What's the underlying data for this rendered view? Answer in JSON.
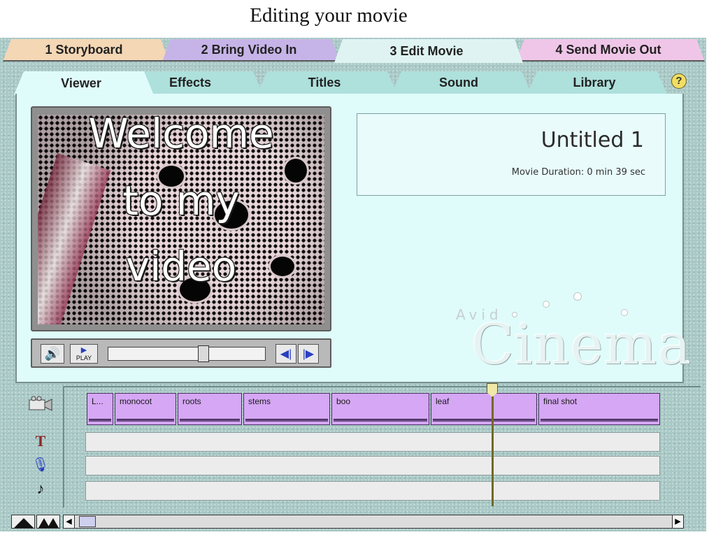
{
  "caption": "Editing your movie",
  "main_tabs": [
    {
      "label": "1 Storyboard",
      "color": "#f4d7b5"
    },
    {
      "label": "2 Bring Video In",
      "color": "#c6b4e8"
    },
    {
      "label": "3 Edit Movie",
      "color": "#dff4f2",
      "active": true
    },
    {
      "label": "4 Send Movie Out",
      "color": "#f0c6e8"
    }
  ],
  "sub_tabs": [
    {
      "label": "Viewer",
      "active": true
    },
    {
      "label": "Effects"
    },
    {
      "label": "Titles"
    },
    {
      "label": "Sound"
    },
    {
      "label": "Library"
    }
  ],
  "help_icon": "?",
  "viewer": {
    "overlay_lines": [
      "Welcome",
      "to my",
      "video"
    ],
    "play_label": "PLAY",
    "speaker_icon": "🔊",
    "prev_icon": "◀|",
    "next_icon": "|▶"
  },
  "movie": {
    "title": "Untitled 1",
    "duration": "Movie Duration: 0 min 39 sec"
  },
  "logo": {
    "avid": "Avid",
    "cinema": "Cinema"
  },
  "timeline": {
    "video_clips": [
      "L...",
      "monocot",
      "roots",
      "stems",
      "boo",
      "leaf",
      "final shot"
    ],
    "track_icons": [
      "video-camera-icon",
      "title-track-icon",
      "microphone-icon",
      "music-note-icon"
    ],
    "title_track_glyph": "T",
    "mic_glyph": "🎙",
    "music_glyph": "♪"
  },
  "scroll_left": "◀",
  "scroll_right": "▶"
}
